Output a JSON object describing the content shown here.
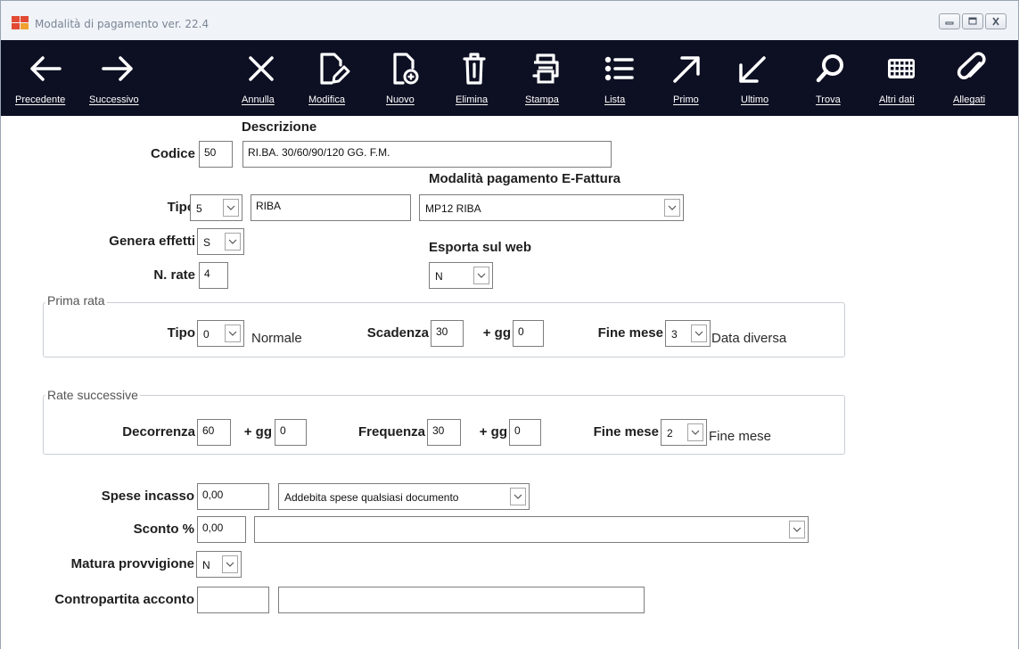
{
  "window": {
    "title": "Modalità di pagamento ver. 22.4"
  },
  "toolbar": {
    "items": [
      {
        "key": "precedente",
        "label": "Precedente",
        "icon": "arrow-left-icon"
      },
      {
        "key": "successivo",
        "label": "Successivo",
        "icon": "arrow-right-icon"
      },
      {
        "key": "annulla",
        "label": "Annulla",
        "icon": "close-icon"
      },
      {
        "key": "modifica",
        "label": "Modifica",
        "icon": "edit-document-icon"
      },
      {
        "key": "nuovo",
        "label": "Nuovo",
        "icon": "new-document-icon"
      },
      {
        "key": "elimina",
        "label": "Elimina",
        "icon": "trash-icon"
      },
      {
        "key": "stampa",
        "label": "Stampa",
        "icon": "printer-icon"
      },
      {
        "key": "lista",
        "label": "Lista",
        "icon": "list-icon"
      },
      {
        "key": "primo",
        "label": "Primo",
        "icon": "arrow-up-right-icon"
      },
      {
        "key": "ultimo",
        "label": "Ultimo",
        "icon": "arrow-down-left-icon"
      },
      {
        "key": "trova",
        "label": "Trova",
        "icon": "search-icon"
      },
      {
        "key": "altri_dati",
        "label": "Altri dati",
        "icon": "keyboard-grid-icon"
      },
      {
        "key": "allegati",
        "label": "Allegati",
        "icon": "paperclip-icon"
      }
    ],
    "colors": {
      "background": "#0d1023",
      "foreground": "#ffffff"
    }
  },
  "form": {
    "descrizione_header": "Descrizione",
    "codice": {
      "label": "Codice",
      "value": "50"
    },
    "descrizione": {
      "value": "RI.BA. 30/60/90/120 GG. F.M."
    },
    "tipo": {
      "label": "Tipo",
      "value": "5",
      "desc": "RIBA"
    },
    "modalita_efattura": {
      "label": "Modalità pagamento E-Fattura",
      "value": "MP12 RIBA"
    },
    "genera_effetti": {
      "label": "Genera effetti",
      "value": "S"
    },
    "esporta_web": {
      "label": "Esporta sul web",
      "value": "N"
    },
    "n_rate": {
      "label": "N. rate",
      "value": "4"
    },
    "prima_rata": {
      "title": "Prima rata",
      "tipo_label": "Tipo",
      "tipo_value": "0",
      "tipo_desc": "Normale",
      "scadenza_label": "Scadenza",
      "scadenza_value": "30",
      "gg_label": "+ gg",
      "gg_value": "0",
      "fine_mese_label": "Fine mese",
      "fine_mese_value": "3",
      "fine_mese_desc": "Data diversa"
    },
    "rate_successive": {
      "title": "Rate successive",
      "decorrenza_label": "Decorrenza",
      "decorrenza_value": "60",
      "gg1_label": "+ gg",
      "gg1_value": "0",
      "frequenza_label": "Frequenza",
      "frequenza_value": "30",
      "gg2_label": "+ gg",
      "gg2_value": "0",
      "fine_mese_label": "Fine mese",
      "fine_mese_value": "2",
      "fine_mese_desc": "Fine mese"
    },
    "spese_incasso": {
      "label": "Spese incasso",
      "value": "0,00",
      "option": "Addebita spese qualsiasi documento"
    },
    "sconto": {
      "label": "Sconto %",
      "value": "0,00",
      "option": ""
    },
    "matura_provvigione": {
      "label": "Matura provvigione",
      "value": "N"
    },
    "contropartita_acconto": {
      "label": "Contropartita acconto",
      "value": "",
      "desc": ""
    }
  }
}
